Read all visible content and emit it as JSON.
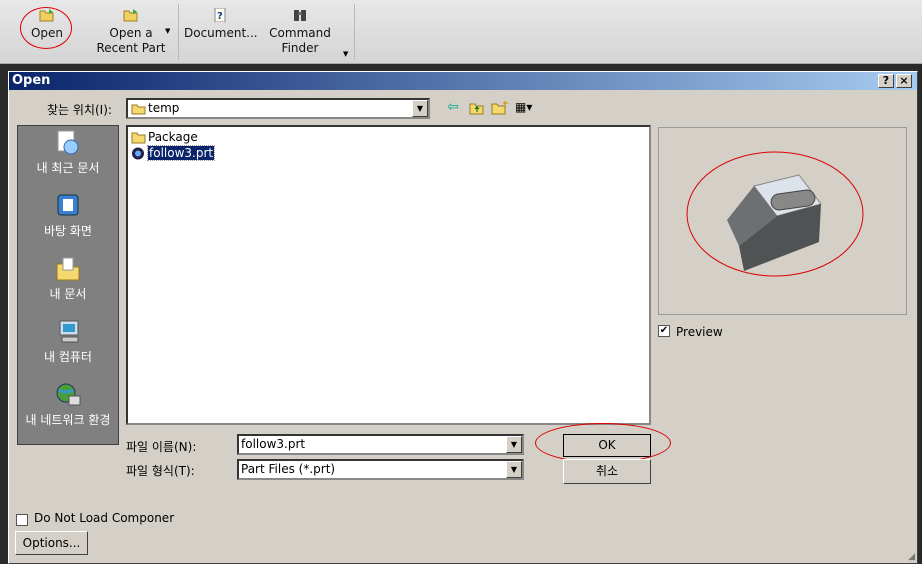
{
  "ribbon": {
    "open": "Open",
    "recent_line1": "Open a",
    "recent_line2": "Recent Part",
    "document": "Document...",
    "finder_line1": "Command",
    "finder_line2": "Finder"
  },
  "dialog": {
    "title": "Open",
    "help": "?",
    "close": "×",
    "look_in_label": "찾는 위치(I):",
    "look_in_value": "temp",
    "places": [
      {
        "label": "내 최근 문서"
      },
      {
        "label": "바탕 화면"
      },
      {
        "label": "내 문서"
      },
      {
        "label": "내 컴퓨터"
      },
      {
        "label": "내 네트워크 환경"
      }
    ],
    "files": [
      {
        "name": "Package",
        "type": "folder"
      },
      {
        "name": "follow3.prt",
        "type": "part"
      }
    ],
    "filename_label": "파일 이름(N):",
    "filename_value": "follow3.prt",
    "filetype_label": "파일 형식(T):",
    "filetype_value": "Part Files (*.prt)",
    "ok": "OK",
    "cancel": "취소",
    "preview_label": "Preview",
    "preview_checked": true,
    "no_load_label": "Do Not Load Componer",
    "no_load_checked": false,
    "options": "Options..."
  }
}
